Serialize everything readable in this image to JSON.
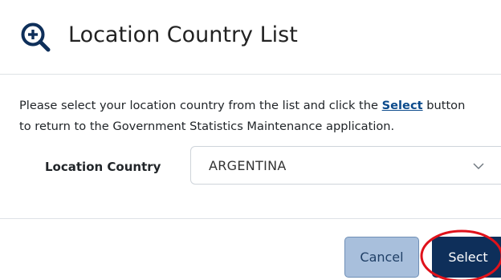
{
  "header": {
    "icon": "zoom-in-magnifier-icon",
    "title": "Location Country List"
  },
  "instructions": {
    "line1_before": "Please select your location country from the list and click the ",
    "line1_link": "Select",
    "line1_after": " button",
    "line2": "to return to the Government Statistics Maintenance application."
  },
  "form": {
    "label": "Location Country",
    "selected_value": "ARGENTINA",
    "dropdown_icon": "chevron-down-icon"
  },
  "buttons": {
    "cancel_label": "Cancel",
    "select_label": "Select"
  },
  "colors": {
    "brand_navy": "#0e2f5a",
    "cancel_bg": "#a8bfdc",
    "highlight_red": "#e0121b",
    "link_blue": "#0b4a8b"
  }
}
